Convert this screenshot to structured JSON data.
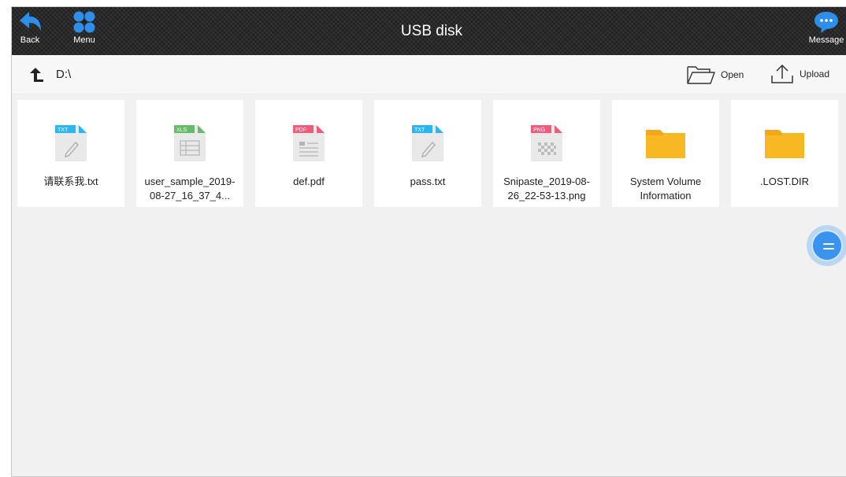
{
  "window": {
    "title": "USB disk"
  },
  "topbar": {
    "back_label": "Back",
    "menu_label": "Menu",
    "message_label": "Message"
  },
  "pathbar": {
    "path": "D:\\",
    "open_label": "Open",
    "upload_label": "Upload"
  },
  "files": [
    {
      "name": "请联系我.txt",
      "type": "TXT",
      "badge_color": "#29b6f6"
    },
    {
      "name": "user_sample_2019-08-27_16_37_4...",
      "type": "XLS",
      "badge_color": "#66bb6a"
    },
    {
      "name": "def.pdf",
      "type": "PDF",
      "badge_color": "#ef5b78"
    },
    {
      "name": "pass.txt",
      "type": "TXT",
      "badge_color": "#29b6f6"
    },
    {
      "name": "Snipaste_2019-08-26_22-53-13.png",
      "type": "PNG",
      "badge_color": "#ef5b78"
    },
    {
      "name": "System Volume Information",
      "type": "folder",
      "badge_color": "#f7b824"
    },
    {
      "name": ".LOST.DIR",
      "type": "folder",
      "badge_color": "#f7b824"
    }
  ],
  "colors": {
    "accent": "#3a93ef",
    "topbar": "#202020",
    "folder": "#f7b824"
  }
}
